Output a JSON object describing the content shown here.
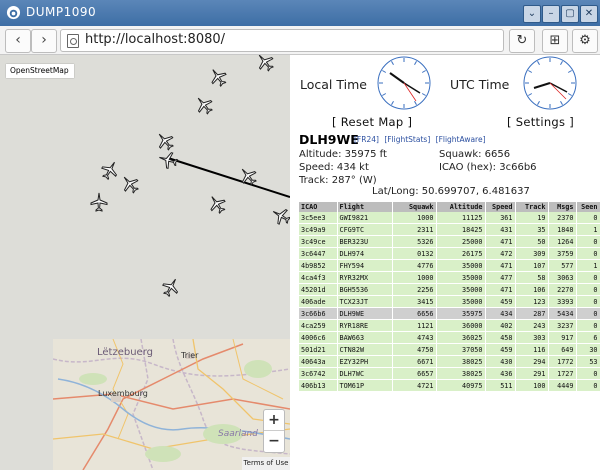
{
  "window": {
    "title": "DUMP1090",
    "buttons": [
      "⌄",
      "–",
      "▢",
      "✕"
    ]
  },
  "browser": {
    "url": "http://localhost:8080/",
    "back": "‹",
    "forward": "›",
    "reload": "↻",
    "install": "⊞",
    "settings": "⚙"
  },
  "map": {
    "layer_label": "OpenStreetMap",
    "zoom_in": "+",
    "zoom_out": "−",
    "terms": "Terms of Use",
    "places": {
      "letzebuerg": "Lëtzebuerg",
      "luxembourg": "Luxembourg",
      "trier": "Trier",
      "saarland": "Saarland"
    }
  },
  "clocks": {
    "local_label": "Local Time",
    "utc_label": "UTC Time"
  },
  "buttons": {
    "reset_map": "[ Reset Map ]",
    "settings": "[ Settings ]"
  },
  "selected": {
    "callsign": "DLH9WE",
    "links": [
      "[FR24]",
      "[FlightStats]",
      "[FlightAware]"
    ],
    "altitude": "Altitude: 35975 ft",
    "squawk": "Squawk: 6656",
    "speed": "Speed: 434 kt",
    "icao": "ICAO (hex): 3c66b6",
    "track": "Track: 287° (W)",
    "latlong": "Lat/Long: 50.699707, 6.481637"
  },
  "table": {
    "headers": [
      "ICAO",
      "Flight",
      "Squawk",
      "Altitude",
      "Speed",
      "Track",
      "Msgs",
      "Seen"
    ],
    "rows": [
      [
        "3c5ee3",
        "GWI9821",
        "1000",
        "11125",
        "361",
        "19",
        "2370",
        "0"
      ],
      [
        "3c49a9",
        "CFG9TC",
        "2311",
        "18425",
        "431",
        "35",
        "1848",
        "1"
      ],
      [
        "3c49ce",
        "BER323U",
        "5326",
        "25000",
        "471",
        "50",
        "1264",
        "0"
      ],
      [
        "3c6447",
        "DLH974",
        "0132",
        "26175",
        "472",
        "309",
        "3759",
        "0"
      ],
      [
        "4b9852",
        "FHY594",
        "4776",
        "35000",
        "471",
        "107",
        "577",
        "1"
      ],
      [
        "4ca4f3",
        "RYR32MX",
        "1000",
        "35000",
        "477",
        "58",
        "3063",
        "0"
      ],
      [
        "45201d",
        "BGH5536",
        "2256",
        "35000",
        "471",
        "106",
        "2270",
        "0"
      ],
      [
        "406ade",
        "TCX23JT",
        "3415",
        "35000",
        "459",
        "123",
        "3393",
        "0"
      ],
      [
        "3c66b6",
        "DLH9WE",
        "6656",
        "35975",
        "434",
        "287",
        "5434",
        "0"
      ],
      [
        "4ca259",
        "RYR18RE",
        "1121",
        "36000",
        "402",
        "243",
        "3237",
        "0"
      ],
      [
        "4006c6",
        "BAW663",
        "4743",
        "36025",
        "458",
        "303",
        "917",
        "6"
      ],
      [
        "501d21",
        "CTN82W",
        "4750",
        "37050",
        "459",
        "116",
        "649",
        "30"
      ],
      [
        "40643a",
        "EZY32PH",
        "6671",
        "38025",
        "430",
        "294",
        "1772",
        "53"
      ],
      [
        "3c6742",
        "DLH7WC",
        "6657",
        "38025",
        "436",
        "291",
        "1727",
        "0"
      ],
      [
        "406b13",
        "TOM61P",
        "4721",
        "40975",
        "511",
        "100",
        "4449",
        "0"
      ]
    ],
    "selected_index": 8
  }
}
